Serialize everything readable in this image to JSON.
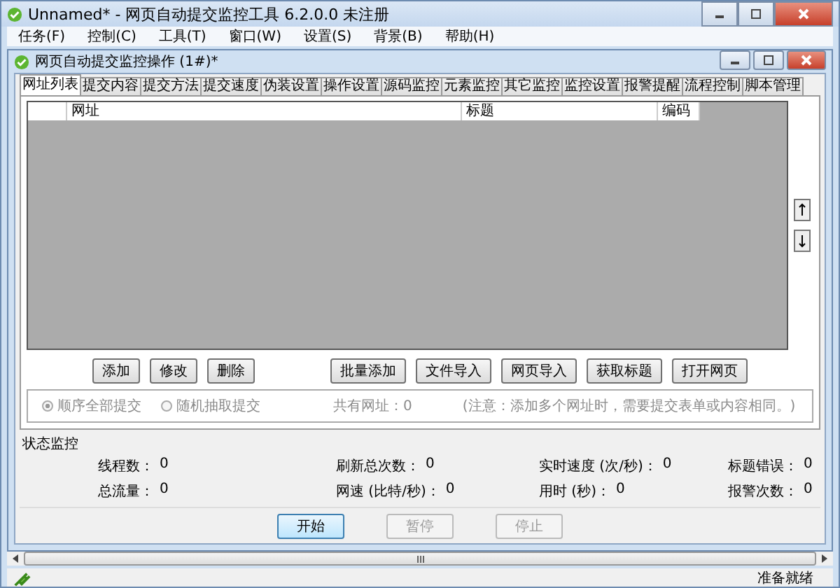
{
  "window": {
    "title": "Unnamed* - 网页自动提交监控工具 6.2.0.0  未注册"
  },
  "menu": [
    {
      "label": "任务(F)"
    },
    {
      "label": "控制(C)"
    },
    {
      "label": "工具(T)"
    },
    {
      "label": "窗口(W)"
    },
    {
      "label": "设置(S)"
    },
    {
      "label": "背景(B)"
    },
    {
      "label": "帮助(H)"
    }
  ],
  "child_window": {
    "title": "网页自动提交监控操作  (1#)*"
  },
  "tabs": [
    {
      "label": "网址列表",
      "selected": true
    },
    {
      "label": "提交内容",
      "selected": false
    },
    {
      "label": "提交方法",
      "selected": false
    },
    {
      "label": "提交速度",
      "selected": false
    },
    {
      "label": "伪装设置",
      "selected": false
    },
    {
      "label": "操作设置",
      "selected": false
    },
    {
      "label": "源码监控",
      "selected": false
    },
    {
      "label": "元素监控",
      "selected": false
    },
    {
      "label": "其它监控",
      "selected": false
    },
    {
      "label": "监控设置",
      "selected": false
    },
    {
      "label": "报警提醒",
      "selected": false
    },
    {
      "label": "流程控制",
      "selected": false
    },
    {
      "label": "脚本管理",
      "selected": false
    }
  ],
  "table": {
    "columns": [
      "网址",
      "标题",
      "编码"
    ]
  },
  "list_buttons": [
    {
      "label": "添加"
    },
    {
      "label": "修改"
    },
    {
      "label": "删除"
    },
    {
      "label": "批量添加"
    },
    {
      "label": "文件导入"
    },
    {
      "label": "网页导入"
    },
    {
      "label": "获取标题"
    },
    {
      "label": "打开网页"
    }
  ],
  "submit_mode": {
    "options": [
      {
        "label": "顺序全部提交",
        "selected": true,
        "disabled": true
      },
      {
        "label": "随机抽取提交",
        "selected": false,
        "disabled": true
      }
    ],
    "count": "共有网址：0",
    "note": "(注意：添加多个网址时，需要提交表单或内容相同。)"
  },
  "status_monitor": {
    "title": "状态监控",
    "stats": [
      {
        "label": "线程数：",
        "value": "0"
      },
      {
        "label": "刷新总次数：",
        "value": "0"
      },
      {
        "label": "实时速度 (次/秒)：",
        "value": "0"
      },
      {
        "label": "标题错误：",
        "value": "0"
      },
      {
        "label": "总流量：",
        "value": "0"
      },
      {
        "label": "网速 (比特/秒)：",
        "value": "0"
      },
      {
        "label": "用时 (秒)：",
        "value": "0"
      },
      {
        "label": "报警次数：",
        "value": "0"
      }
    ]
  },
  "control_buttons": [
    {
      "label": "开始",
      "disabled": false
    },
    {
      "label": "暂停",
      "disabled": true
    },
    {
      "label": "停止",
      "disabled": true
    }
  ],
  "status_bar": {
    "text": "准备就绪"
  }
}
